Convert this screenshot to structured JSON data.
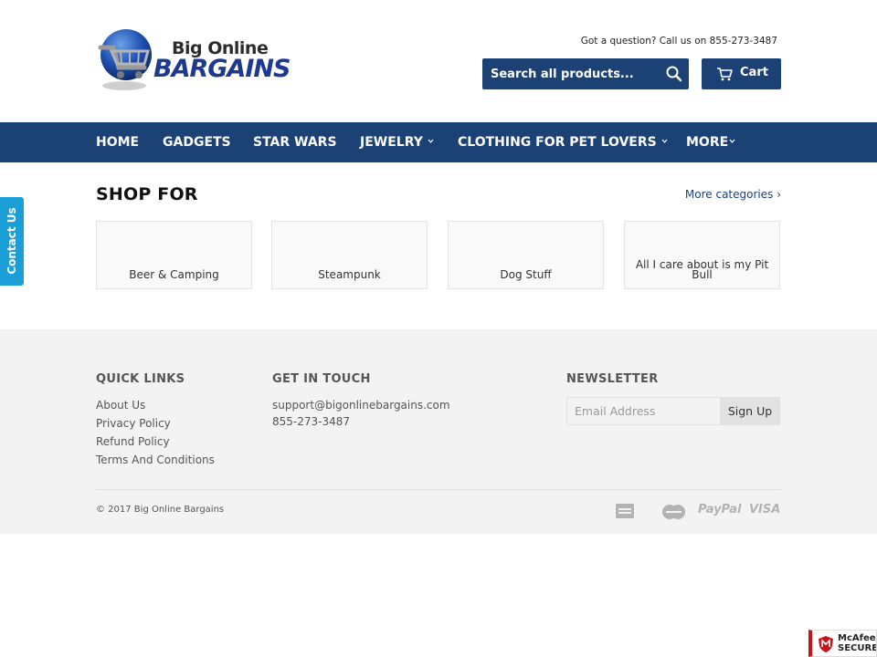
{
  "header": {
    "logo_top": "Big Online",
    "logo_bottom": "BARGAINS",
    "question": "Got a question? Call us on 855-273-3487",
    "search_placeholder": "Search all products...",
    "cart_label": "Cart"
  },
  "nav": {
    "items": [
      {
        "label": "HOME"
      },
      {
        "label": "GADGETS"
      },
      {
        "label": "STAR WARS"
      },
      {
        "label": "JEWELRY"
      },
      {
        "label": "CLOTHING FOR PET LOVERS"
      },
      {
        "label": "MORE"
      }
    ]
  },
  "shop": {
    "title": "SHOP FOR",
    "more_link": "More categories ›",
    "categories": [
      {
        "label": "Beer & Camping"
      },
      {
        "label": "Steampunk"
      },
      {
        "label": "Dog Stuff"
      },
      {
        "label": "All I care about is my Pit Bull"
      }
    ]
  },
  "contact_tab": {
    "label": "Contact Us"
  },
  "footer": {
    "quick_links": {
      "heading": "QUICK LINKS",
      "links": [
        "About Us",
        "Privacy Policy",
        "Refund Policy",
        "Terms And Conditions"
      ]
    },
    "get_in_touch": {
      "heading": "GET IN TOUCH",
      "email": "support@bigonlinebargains.com",
      "phone": "855-273-3487"
    },
    "newsletter": {
      "heading": "NEWSLETTER",
      "email_placeholder": "Email Address",
      "signup_label": "Sign Up"
    },
    "copyright": "© 2017 Big Online Bargains",
    "payments": [
      "PayPal",
      "VISA"
    ]
  },
  "badge": {
    "line1": "McAfee",
    "line2": "SECURE"
  },
  "colors": {
    "brand_blue": "#1c4174",
    "contact_blue": "#1a9fd9",
    "footer_bg": "#f3f3f3"
  }
}
